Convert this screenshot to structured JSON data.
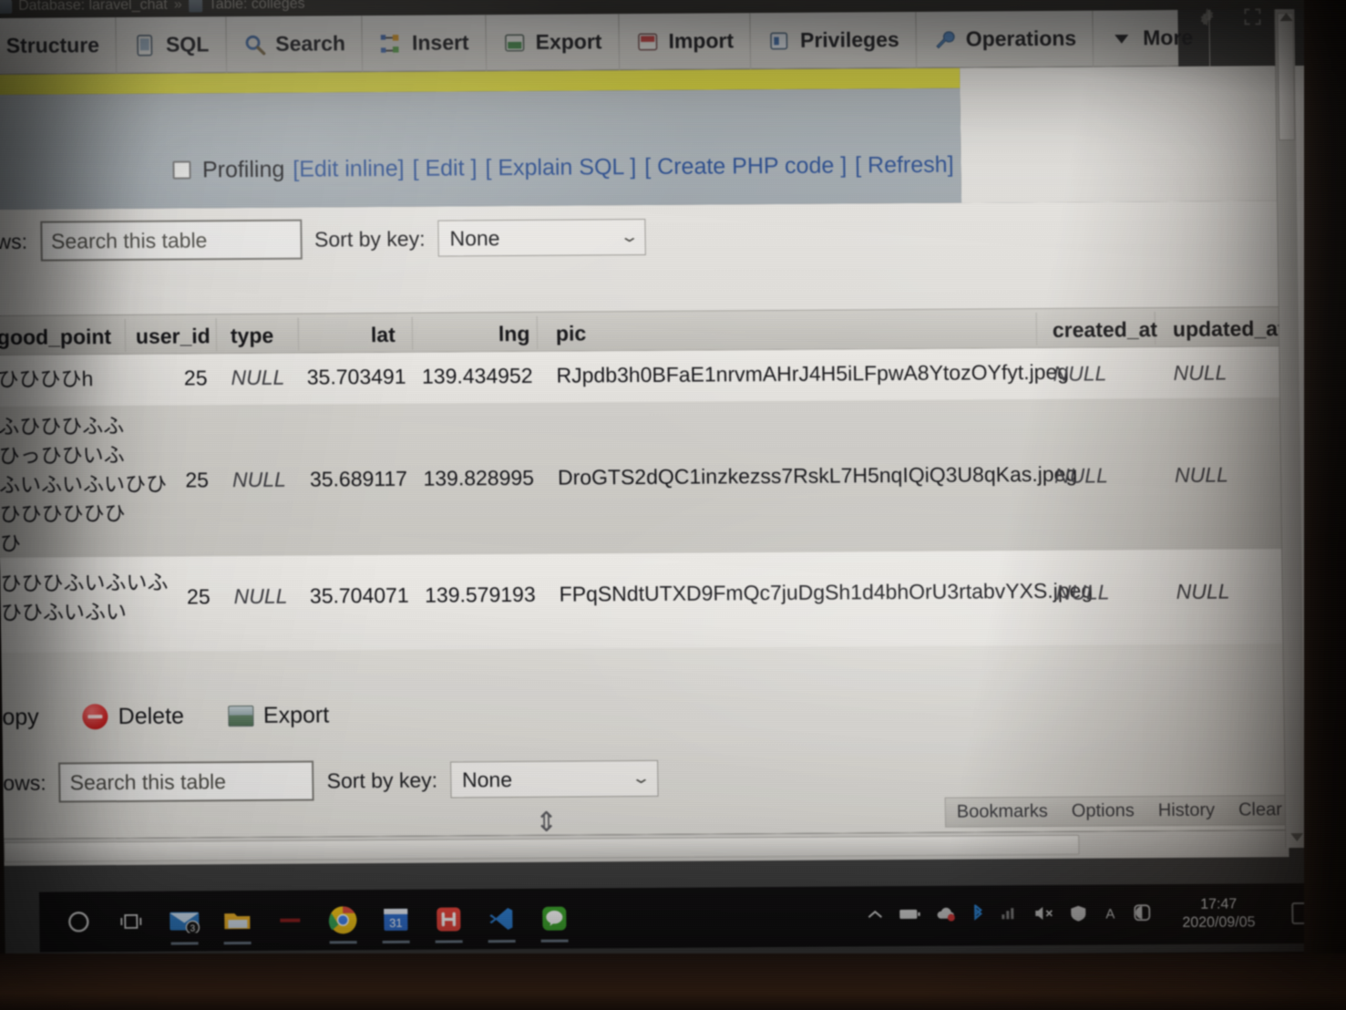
{
  "breadcrumb": {
    "database_label": "Database: laravel_chat",
    "separator": "»",
    "table_label": "Table: colleges"
  },
  "nav_tabs": [
    {
      "label": "Structure",
      "icon": "structure-icon"
    },
    {
      "label": "SQL",
      "icon": "sql-icon"
    },
    {
      "label": "Search",
      "icon": "search-icon"
    },
    {
      "label": "Insert",
      "icon": "insert-icon"
    },
    {
      "label": "Export",
      "icon": "export-icon"
    },
    {
      "label": "Import",
      "icon": "import-icon"
    },
    {
      "label": "Privileges",
      "icon": "privileges-icon"
    },
    {
      "label": "Operations",
      "icon": "operations-icon"
    },
    {
      "label": "More",
      "icon": "chevron-down-icon"
    }
  ],
  "profiling": {
    "checkbox_label": "Profiling",
    "links": [
      "[Edit inline]",
      "[ Edit ]",
      "[ Explain SQL ]",
      "[ Create PHP code ]",
      "[ Refresh]"
    ]
  },
  "filter_top": {
    "rows_label": "ws:",
    "search_placeholder": "Search this table",
    "sort_label": "Sort by key:",
    "sort_value": "None"
  },
  "filter_bottom": {
    "rows_label": "ows:",
    "search_placeholder": "Search this table",
    "sort_label": "Sort by key:",
    "sort_value": "None"
  },
  "results_table": {
    "columns": [
      "good_point",
      "user_id",
      "type",
      "lat",
      "lng",
      "pic",
      "created_at",
      "updated_at"
    ],
    "rows": [
      {
        "good_point": "ひひひひh",
        "user_id": "25",
        "type": "NULL",
        "lat": "35.703491",
        "lng": "139.434952",
        "pic": "RJpdb3h0BFaE1nrvmAHrJ4H5iLFpwA8YtozOYfyt.jpeg",
        "created_at": "NULL",
        "updated_at": "NULL"
      },
      {
        "good_point": "ふひひひふふ\nひっひひいふ\nふいふいふいひひ\nひひひひひひ\nひ",
        "user_id": "25",
        "type": "NULL",
        "lat": "35.689117",
        "lng": "139.828995",
        "pic": "DroGTS2dQC1inzkezss7RskL7H5nqIQiQ3U8qKas.jpeg",
        "created_at": "NULL",
        "updated_at": "NULL"
      },
      {
        "good_point": "ひひひふいふいふ\nひひふいふい",
        "user_id": "25",
        "type": "NULL",
        "lat": "35.704071",
        "lng": "139.579193",
        "pic": "FPqSNdtUTXD9FmQc7juDgSh1d4bhOrU3rtabvYXS.jpeg",
        "created_at": "NULL",
        "updated_at": "NULL"
      }
    ]
  },
  "row_actions": [
    {
      "label": "opy",
      "icon": "copy-icon"
    },
    {
      "label": "Delete",
      "icon": "delete-icon"
    },
    {
      "label": "Export",
      "icon": "export-icon"
    }
  ],
  "bottom_links": [
    "Bookmarks",
    "Options",
    "History",
    "Clear"
  ],
  "taskbar": {
    "icons": [
      "cortana-circle-icon",
      "task-view-icon",
      "mail-icon",
      "file-explorer-icon",
      "red-app-icon",
      "chrome-icon",
      "calendar-icon",
      "xampp-icon",
      "vscode-icon",
      "line-icon"
    ],
    "mail_badge": "3",
    "tray": [
      "show-hidden-icons-icon",
      "battery-icon",
      "onedrive-icon",
      "bluetooth-icon",
      "network-icon",
      "volume-muted-icon",
      "security-icon",
      "ime-icon",
      "accessibility-icon"
    ],
    "clock_time": "17:47",
    "clock_date": "2020/09/05",
    "action_center": "action-center-icon"
  },
  "colors": {
    "accent_yellow": "#e9e44a",
    "link_blue": "#2a4d8f",
    "delete_red": "#cc2222",
    "taskbar_bg": "#100f10"
  }
}
